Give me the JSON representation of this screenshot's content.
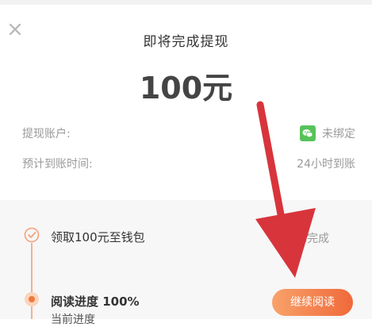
{
  "dialog": {
    "title": "即将完成提现",
    "amount": "100元"
  },
  "account": {
    "label": "提现账户:",
    "value": "未绑定",
    "icon": "wechat-icon"
  },
  "arrival": {
    "label": "预计到账时间:",
    "value": "24小时到账"
  },
  "tasks": [
    {
      "label": "领取100元至钱包",
      "status": "已完成"
    },
    {
      "label": "阅读进度 100%",
      "sub": "当前进度",
      "action": "继续阅读"
    }
  ],
  "colors": {
    "accent": "#f0693a",
    "wechat": "#57c25a",
    "annotation_arrow": "#d8343c"
  }
}
